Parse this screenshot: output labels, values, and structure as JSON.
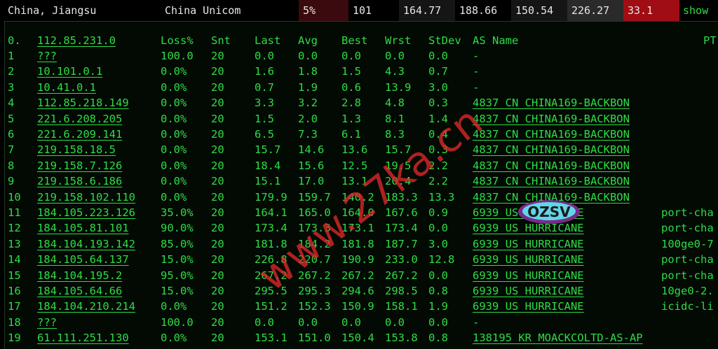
{
  "header": {
    "location": "China, Jiangsu",
    "isp": "China Unicom",
    "loss": "5%",
    "sent": "101",
    "last": "164.77",
    "avg": "188.66",
    "best": "150.54",
    "worst": "226.27",
    "stdev": "33.1",
    "show_label": "show",
    "colors": {
      "loss_bg": "#3a0a0e",
      "worst_bg": "#2a2a2a",
      "stdev_bg": "#a00d14",
      "show_color": "#2fdc45"
    }
  },
  "columns": {
    "hop": "0.",
    "host": "112.85.231.0",
    "loss": "Loss%",
    "snt": "Snt",
    "last": "Last",
    "avg": "Avg",
    "best": "Best",
    "wrst": "Wrst",
    "stdev": "StDev",
    "as_name": "AS Name",
    "ptr": "PT"
  },
  "rows": [
    {
      "hop": "1",
      "host": "???",
      "loss": "100.0",
      "snt": "20",
      "last": "0.0",
      "avg": "0.0",
      "best": "0.0",
      "wrst": "0.0",
      "stdev": "0.0",
      "as": "-",
      "ptr": ""
    },
    {
      "hop": "2",
      "host": "10.101.0.1",
      "loss": "0.0%",
      "snt": "20",
      "last": "1.6",
      "avg": "1.8",
      "best": "1.5",
      "wrst": "4.3",
      "stdev": "0.7",
      "as": "-",
      "ptr": ""
    },
    {
      "hop": "3",
      "host": "10.41.0.1",
      "loss": "0.0%",
      "snt": "20",
      "last": "0.7",
      "avg": "1.9",
      "best": "0.6",
      "wrst": "13.9",
      "stdev": "3.0",
      "as": "-",
      "ptr": ""
    },
    {
      "hop": "4",
      "host": "112.85.218.149",
      "loss": "0.0%",
      "snt": "20",
      "last": "3.3",
      "avg": "3.2",
      "best": "2.8",
      "wrst": "4.8",
      "stdev": "0.3",
      "as": "4837  CN CHINA169-BACKBON",
      "ptr": ""
    },
    {
      "hop": "5",
      "host": "221.6.208.205",
      "loss": "0.0%",
      "snt": "20",
      "last": "1.5",
      "avg": "2.0",
      "best": "1.3",
      "wrst": "8.1",
      "stdev": "1.4",
      "as": "4837  CN CHINA169-BACKBON",
      "ptr": ""
    },
    {
      "hop": "6",
      "host": "221.6.209.141",
      "loss": "0.0%",
      "snt": "20",
      "last": "6.5",
      "avg": "7.3",
      "best": "6.1",
      "wrst": "8.3",
      "stdev": "0.4",
      "as": "4837  CN CHINA169-BACKBON",
      "ptr": ""
    },
    {
      "hop": "7",
      "host": "219.158.18.5",
      "loss": "0.0%",
      "snt": "20",
      "last": "15.7",
      "avg": "14.6",
      "best": "13.6",
      "wrst": "15.7",
      "stdev": "0.3",
      "as": "4837  CN CHINA169-BACKBON",
      "ptr": ""
    },
    {
      "hop": "8",
      "host": "219.158.7.126",
      "loss": "0.0%",
      "snt": "20",
      "last": "18.4",
      "avg": "15.6",
      "best": "12.5",
      "wrst": "19.5",
      "stdev": "2.2",
      "as": "4837  CN CHINA169-BACKBON",
      "ptr": ""
    },
    {
      "hop": "9",
      "host": "219.158.6.186",
      "loss": "0.0%",
      "snt": "20",
      "last": "15.1",
      "avg": "17.0",
      "best": "13.1",
      "wrst": "20.4",
      "stdev": "2.2",
      "as": "4837  CN CHINA169-BACKBON",
      "ptr": ""
    },
    {
      "hop": "10",
      "host": "219.158.102.110",
      "loss": "0.0%",
      "snt": "20",
      "last": "179.9",
      "avg": "159.7",
      "best": "140.2",
      "wrst": "183.3",
      "stdev": "13.3",
      "as": "4837  CN CHINA169-BACKBON",
      "ptr": ""
    },
    {
      "hop": "11",
      "host": "184.105.223.126",
      "loss": "35.0%",
      "snt": "20",
      "last": "164.1",
      "avg": "165.0",
      "best": "164.0",
      "wrst": "167.6",
      "stdev": "0.9",
      "as": "6939  US HURRICANE",
      "ptr": "port-cha"
    },
    {
      "hop": "12",
      "host": "184.105.81.101",
      "loss": "90.0%",
      "snt": "20",
      "last": "173.4",
      "avg": "173.3",
      "best": "173.1",
      "wrst": "173.4",
      "stdev": "0.0",
      "as": "6939  US HURRICANE",
      "ptr": "port-cha"
    },
    {
      "hop": "13",
      "host": "184.104.193.142",
      "loss": "85.0%",
      "snt": "20",
      "last": "181.8",
      "avg": "184.2",
      "best": "181.8",
      "wrst": "187.7",
      "stdev": "3.0",
      "as": "6939  US HURRICANE",
      "ptr": "100ge0-7"
    },
    {
      "hop": "14",
      "host": "184.105.64.137",
      "loss": "15.0%",
      "snt": "20",
      "last": "226.8",
      "avg": "220.7",
      "best": "190.9",
      "wrst": "233.0",
      "stdev": "12.8",
      "as": "6939  US HURRICANE",
      "ptr": "port-cha"
    },
    {
      "hop": "15",
      "host": "184.104.195.2",
      "loss": "95.0%",
      "snt": "20",
      "last": "267.2",
      "avg": "267.2",
      "best": "267.2",
      "wrst": "267.2",
      "stdev": "0.0",
      "as": "6939  US HURRICANE",
      "ptr": "port-cha"
    },
    {
      "hop": "16",
      "host": "184.105.64.66",
      "loss": "15.0%",
      "snt": "20",
      "last": "295.5",
      "avg": "295.3",
      "best": "294.6",
      "wrst": "298.5",
      "stdev": "0.8",
      "as": "6939  US HURRICANE",
      "ptr": "10ge0-2."
    },
    {
      "hop": "17",
      "host": "184.104.210.214",
      "loss": "0.0%",
      "snt": "20",
      "last": "151.2",
      "avg": "152.3",
      "best": "150.9",
      "wrst": "158.1",
      "stdev": "1.9",
      "as": "6939  US HURRICANE",
      "ptr": "icidc-li"
    },
    {
      "hop": "18",
      "host": "???",
      "loss": "100.0",
      "snt": "20",
      "last": "0.0",
      "avg": "0.0",
      "best": "0.0",
      "wrst": "0.0",
      "stdev": "0.0",
      "as": "-",
      "ptr": ""
    },
    {
      "hop": "19",
      "host": "61.111.251.130",
      "loss": "0.0%",
      "snt": "20",
      "last": "153.1",
      "avg": "151.0",
      "best": "150.4",
      "wrst": "153.8",
      "stdev": "0.8",
      "as": "138195 KR MOACKCOLTD-AS-AP",
      "ptr": ""
    }
  ],
  "watermark": {
    "text": "www.27ka.cn",
    "badge": "OZSV",
    "color": "#e0282a"
  },
  "text_color": "#2fdc45"
}
